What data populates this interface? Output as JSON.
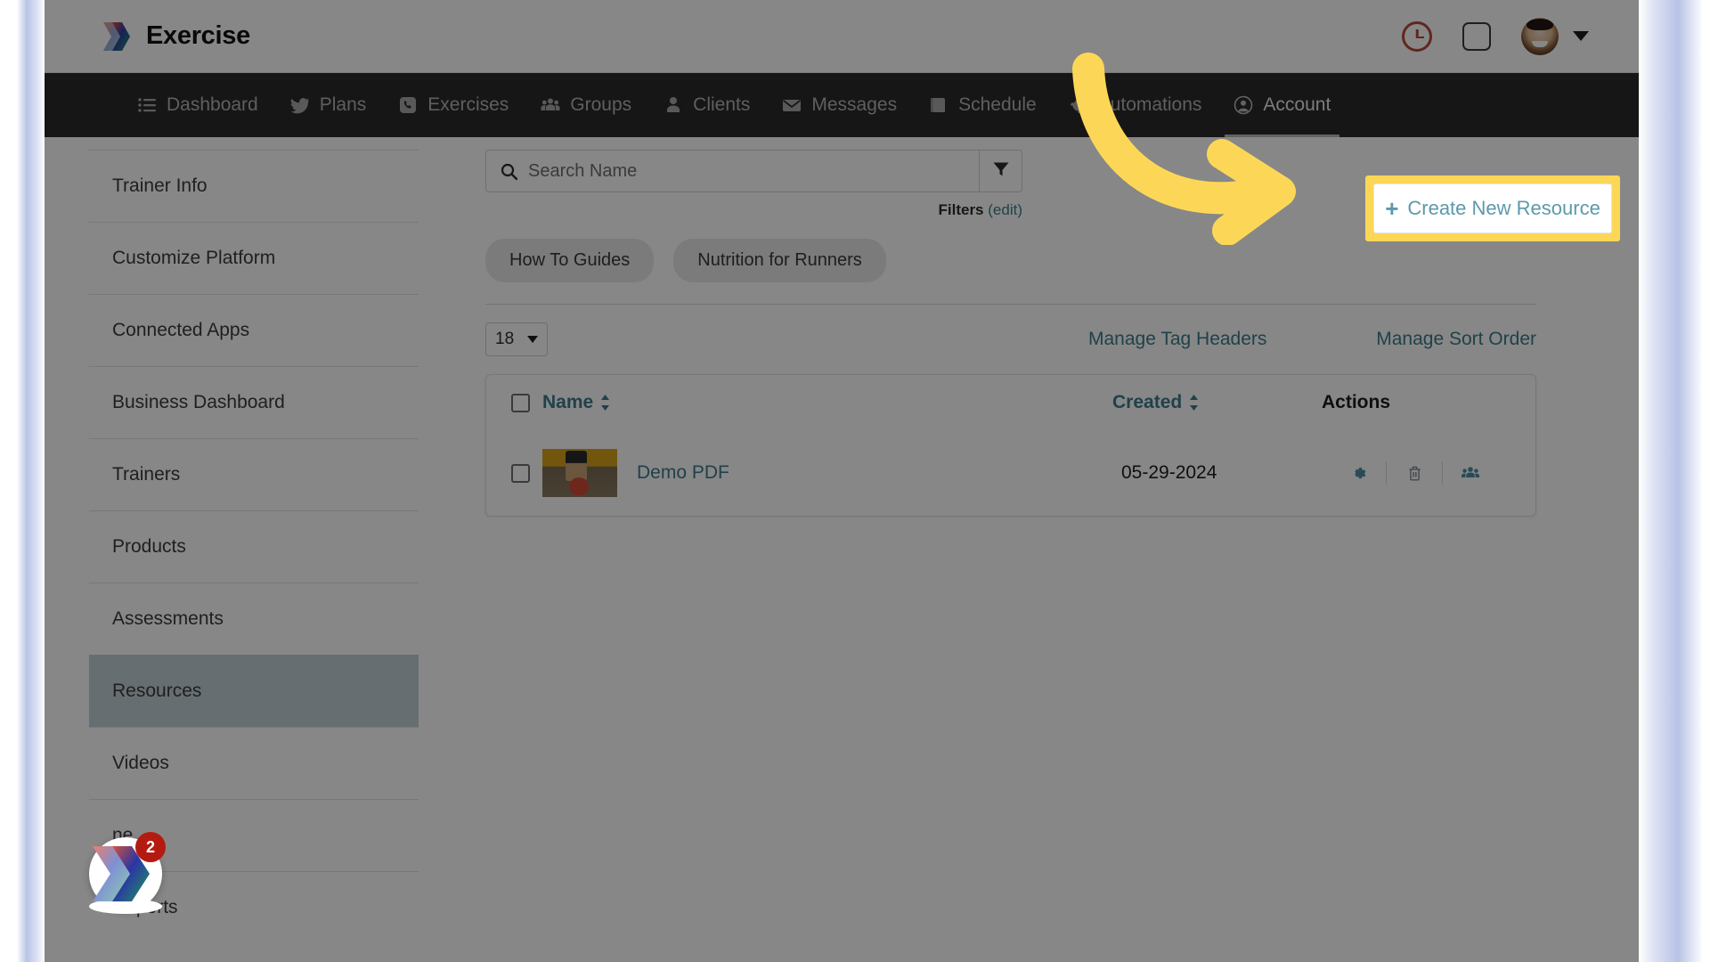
{
  "app": {
    "brand_name": "Exercise",
    "logo_icon": "exercise-chevrons-logo"
  },
  "topbar": {
    "clock_icon": "clock-icon",
    "square_icon": "square-icon",
    "avatar_icon": "user-avatar",
    "chevron_icon": "chevron-down-icon"
  },
  "nav": {
    "items": [
      {
        "label": "Dashboard",
        "icon": "list-icon",
        "active": false
      },
      {
        "label": "Plans",
        "icon": "bird-icon",
        "active": false
      },
      {
        "label": "Exercises",
        "icon": "phone-icon",
        "active": false
      },
      {
        "label": "Groups",
        "icon": "users-group-icon",
        "active": false
      },
      {
        "label": "Clients",
        "icon": "person-icon",
        "active": false
      },
      {
        "label": "Messages",
        "icon": "envelope-icon",
        "active": false
      },
      {
        "label": "Schedule",
        "icon": "book-icon",
        "active": false
      },
      {
        "label": "Automations",
        "icon": "rocket-icon",
        "active": false
      },
      {
        "label": "Account",
        "icon": "account-circle-icon",
        "active": true
      }
    ]
  },
  "sidebar": {
    "items": [
      {
        "label": "Trainer Info",
        "active": false
      },
      {
        "label": "Customize Platform",
        "active": false
      },
      {
        "label": "Connected Apps",
        "active": false
      },
      {
        "label": "Business Dashboard",
        "active": false
      },
      {
        "label": "Trainers",
        "active": false
      },
      {
        "label": "Products",
        "active": false
      },
      {
        "label": "Assessments",
        "active": false
      },
      {
        "label": "Resources",
        "active": true
      },
      {
        "label": "Videos",
        "active": false
      },
      {
        "label": "ne",
        "active": false
      },
      {
        "label": "Reports",
        "active": false
      }
    ]
  },
  "search": {
    "placeholder": "Search Name",
    "value": "",
    "search_icon": "search-icon",
    "filter_icon": "funnel-icon",
    "filters_label": "Filters",
    "filters_edit_label": "(edit)"
  },
  "tags": [
    {
      "label": "How To Guides"
    },
    {
      "label": "Nutrition for Runners"
    }
  ],
  "toolbar": {
    "page_size": "18",
    "manage_tag_headers": "Manage Tag Headers",
    "manage_sort_order": "Manage Sort Order"
  },
  "table": {
    "columns": [
      {
        "key": "name",
        "label": "Name",
        "sortable": true
      },
      {
        "key": "created",
        "label": "Created",
        "sortable": true
      },
      {
        "key": "actions",
        "label": "Actions",
        "sortable": false
      }
    ],
    "rows": [
      {
        "name": "Demo PDF",
        "created": "05-29-2024",
        "thumbnail": "kettlebell-photo-thumbnail",
        "actions": [
          "gear-icon",
          "trash-icon",
          "share-users-icon"
        ]
      }
    ]
  },
  "cta": {
    "plus": "+",
    "label": "Create New Resource",
    "highlight_color": "#fcd757"
  },
  "annotation": {
    "arrow_color": "#fcd757",
    "arrow_icon": "curved-arrow-icon"
  },
  "bubble": {
    "badge_count": "2",
    "icon": "exercise-chevrons-logo"
  },
  "colors": {
    "nav_bg": "#2a2a2a",
    "link": "#3d7c8c",
    "sidebar_active": "#c3d0d6",
    "highlight": "#fcd757",
    "badge": "#b51a10"
  }
}
